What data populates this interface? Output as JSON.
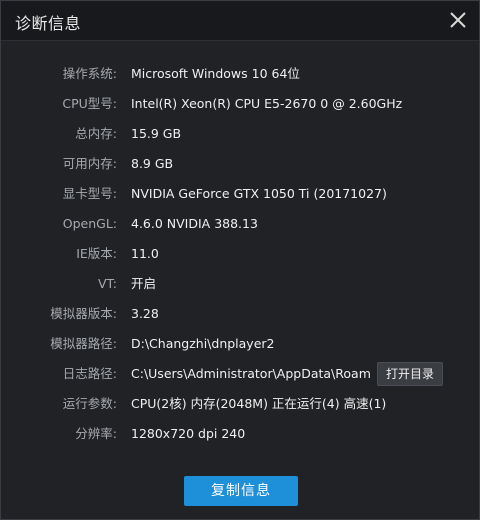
{
  "window": {
    "title": "诊断信息",
    "close_icon": "close-icon"
  },
  "info": [
    {
      "label": "操作系统:",
      "value": "Microsoft Windows 10 64位"
    },
    {
      "label": "CPU型号:",
      "value": "Intel(R) Xeon(R) CPU E5-2670 0 @ 2.60GHz"
    },
    {
      "label": "总内存:",
      "value": "15.9 GB"
    },
    {
      "label": "可用内存:",
      "value": "8.9 GB"
    },
    {
      "label": "显卡型号:",
      "value": "NVIDIA GeForce GTX 1050 Ti (20171027)"
    },
    {
      "label": "OpenGL:",
      "value": "4.6.0 NVIDIA 388.13"
    },
    {
      "label": "IE版本:",
      "value": "11.0"
    },
    {
      "label": "VT:",
      "value": "开启"
    },
    {
      "label": "模拟器版本:",
      "value": "3.28"
    },
    {
      "label": "模拟器路径:",
      "value": "D:\\Changzhi\\dnplayer2"
    },
    {
      "label": "日志路径:",
      "value": "C:\\Users\\Administrator\\AppData\\Roami"
    },
    {
      "label": "运行参数:",
      "value": "CPU(2核) 内存(2048M) 正在运行(4) 高速(1)"
    },
    {
      "label": "分辨率:",
      "value": "1280x720 dpi 240"
    }
  ],
  "buttons": {
    "open_dir": "打开目录",
    "copy": "复制信息"
  },
  "colors": {
    "background": "#202226",
    "titlebar": "#17191c",
    "accent": "#1e8fd9",
    "label": "#a6a9ad",
    "value": "#f0f0f0"
  }
}
